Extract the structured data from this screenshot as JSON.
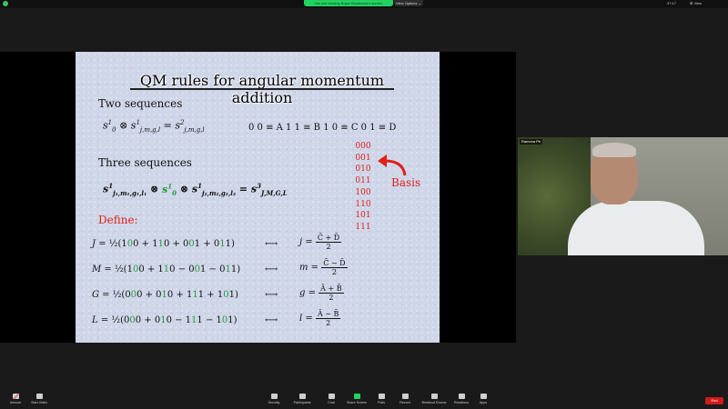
{
  "topbar": {
    "share_notice": "You are viewing Bojan Bosanovic's screen",
    "view_options": "View Options ⌄",
    "clock": "37:17",
    "view_label": "⊞ View"
  },
  "slide": {
    "title": "QM rules for angular momentum addition",
    "two_sequences_label": "Two sequences",
    "three_sequences_label": "Three sequences",
    "define_label": "Define:",
    "mapping": "0 0 ≡ A    1 1 ≡ B    1 0 ≡ C    0 1 ≡ D",
    "basis_label": "Basis",
    "basis": [
      "000",
      "001",
      "010",
      "011",
      "100",
      "110",
      "101",
      "111"
    ]
  },
  "video": {
    "participant_name": "Ramona Pe"
  },
  "toolbar": {
    "items": [
      {
        "label": "Unmute"
      },
      {
        "label": "Start Video"
      },
      {
        "label": "Security"
      },
      {
        "label": "Participants"
      },
      {
        "label": "Chat"
      },
      {
        "label": "Share Screen"
      },
      {
        "label": "Polls"
      },
      {
        "label": "Record"
      },
      {
        "label": "Breakout Rooms"
      },
      {
        "label": "Reactions"
      },
      {
        "label": "Apps"
      }
    ],
    "participants_count": "28",
    "end_label": "End"
  },
  "colors": {
    "share_green": "#23d160",
    "end_red": "#d11a1a",
    "accent_red": "#e0201a",
    "accent_green": "#1f9a3a"
  }
}
